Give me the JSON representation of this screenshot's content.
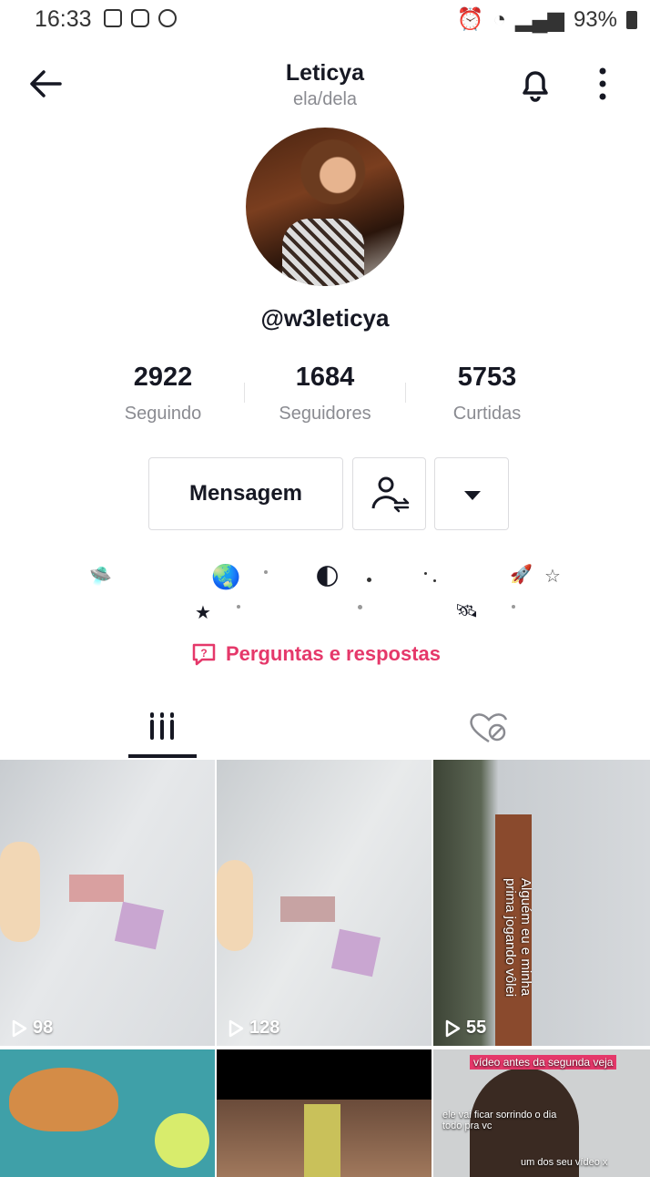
{
  "status_bar": {
    "time": "16:33",
    "battery": "93%"
  },
  "header": {
    "name": "Leticya",
    "pronouns": "ela/dela"
  },
  "profile": {
    "username": "@w3leticya"
  },
  "stats": [
    {
      "value": "2922",
      "label": "Seguindo"
    },
    {
      "value": "1684",
      "label": "Seguidores"
    },
    {
      "value": "5753",
      "label": "Curtidas"
    }
  ],
  "actions": {
    "message_label": "Mensagem"
  },
  "qa": {
    "label": "Perguntas e respostas"
  },
  "videos": [
    {
      "views": "98"
    },
    {
      "views": "128"
    },
    {
      "views": "55",
      "caption": "Alguém eu e minha prima jogando vôlei"
    },
    {
      "views": ""
    },
    {
      "views": ""
    },
    {
      "views": "",
      "caption_top": "vídeo antes da segunda veja",
      "caption_mid": "ele vai ficar sorrindo o dia todo pra vc",
      "caption_bottom": "um dos seu vídeo x"
    }
  ],
  "colors": {
    "accent_pink": "#e5386a",
    "text": "#161823",
    "muted": "#8a8b91"
  }
}
